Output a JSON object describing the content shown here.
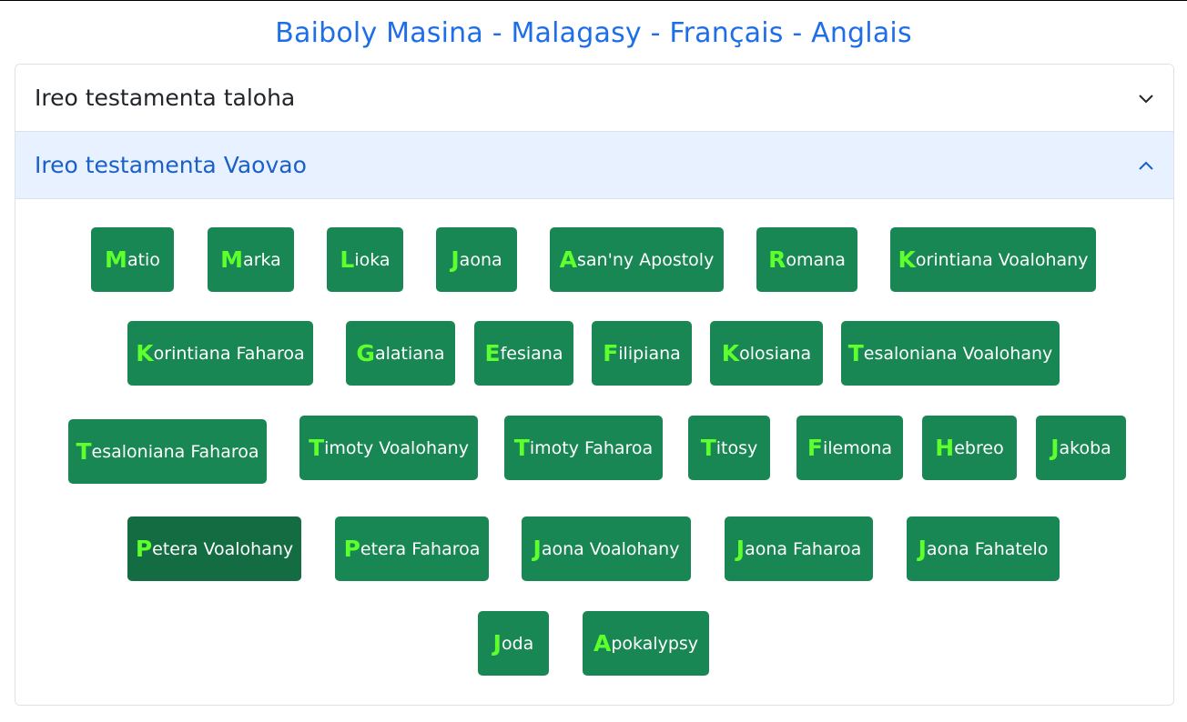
{
  "header": {
    "title": "Baiboly Masina - Malagasy - Français - Anglais"
  },
  "accordion": {
    "old_testament": {
      "label": "Ireo testamenta taloha",
      "expanded": false
    },
    "new_testament": {
      "label": "Ireo testamenta Vaovao",
      "expanded": true
    }
  },
  "colors": {
    "title": "#1e6ee8",
    "button_bg": "#198754",
    "button_active_bg": "#146c43",
    "first_letter": "#5dff2c",
    "active_header_bg": "#e7f1ff"
  },
  "books": [
    {
      "first": "M",
      "rest": "atio"
    },
    {
      "first": "M",
      "rest": "arka"
    },
    {
      "first": "L",
      "rest": "ioka"
    },
    {
      "first": "J",
      "rest": "aona"
    },
    {
      "first": "A",
      "rest": "san'ny Apostoly"
    },
    {
      "first": "R",
      "rest": "omana"
    },
    {
      "first": "K",
      "rest": "orintiana Voalohany"
    },
    {
      "first": "K",
      "rest": "orintiana Faharoa"
    },
    {
      "first": "G",
      "rest": "alatiana"
    },
    {
      "first": "E",
      "rest": "fesiana"
    },
    {
      "first": "F",
      "rest": "ilipiana"
    },
    {
      "first": "K",
      "rest": "olosiana"
    },
    {
      "first": "T",
      "rest": "esaloniana Voalohany"
    },
    {
      "first": "T",
      "rest": "esaloniana Faharoa"
    },
    {
      "first": "T",
      "rest": "imoty Voalohany"
    },
    {
      "first": "T",
      "rest": "imoty Faharoa"
    },
    {
      "first": "T",
      "rest": "itosy"
    },
    {
      "first": "F",
      "rest": "ilemona"
    },
    {
      "first": "H",
      "rest": "ebreo"
    },
    {
      "first": "J",
      "rest": "akoba"
    },
    {
      "first": "P",
      "rest": "etera Voalohany",
      "active": true
    },
    {
      "first": "P",
      "rest": "etera Faharoa"
    },
    {
      "first": "J",
      "rest": "aona Voalohany"
    },
    {
      "first": "J",
      "rest": "aona Faharoa"
    },
    {
      "first": "J",
      "rest": "aona Fahatelo"
    },
    {
      "first": "J",
      "rest": "oda"
    },
    {
      "first": "A",
      "rest": "pokalypsy"
    }
  ]
}
